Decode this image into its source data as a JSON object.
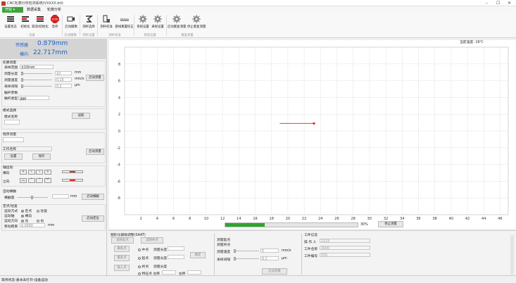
{
  "title": "CNC轮廓分析检测系统(VXXXX.btl)",
  "menu": {
    "start": "开始",
    "data": "数据采集",
    "analysis": "轮廓分析"
  },
  "ribbon": {
    "b1": "设置状态",
    "b2": "初始化",
    "b3": "取消/初始化",
    "b4": "急停",
    "b5": "启动摄像",
    "b6": "测杆选择",
    "b7": "测杆校准",
    "b8": "基线重置校正",
    "b9": "系统设置",
    "b10": "采样设置",
    "b11": "启动重复测量",
    "b12": "停止重复测量",
    "g1": "设备",
    "g2": "启动摄像",
    "g3": "测杆设置",
    "g4": "测杆校准",
    "g5": "系统设置",
    "g6": "重复测量"
  },
  "sensor": {
    "label1": "传感器",
    "value1": "0.879mm",
    "label2": "横向",
    "value2": "22.717mm"
  },
  "measure": {
    "section": "轮廓测量",
    "range_label": "采样范围",
    "range_value": "±10mm",
    "length_label": "测量长度",
    "length_value": "10",
    "length_unit": "mm",
    "speed_label": "测量速度",
    "speed_value": "0.15",
    "speed_unit": "mm/s",
    "interval_label": "采样间隔",
    "interval_value": "0.2",
    "interval_unit": "μm",
    "start_btn": "启动测量",
    "probe_params": "触杆参数",
    "probe_type_label": "触杆类型",
    "probe_type_value": "测杆"
  },
  "template": {
    "section": "模式选择",
    "name_label": "模式名称",
    "name_value": "",
    "load_btn": "读取"
  },
  "program": {
    "section": "程序测量",
    "file_label": "工作名称",
    "set_btn": "设置",
    "save_btn": "保存",
    "run_btn": "启动测量"
  },
  "motion": {
    "section": "轴运动",
    "h_label": "横向",
    "v_label": "立向"
  },
  "auto": {
    "section": "自动横触",
    "reach_label": "横触量",
    "reach_unit": "mm",
    "btn": "启动横触"
  },
  "pos": {
    "section": "定点/往复",
    "mode_label": "运动方式",
    "mode_opt1": "定点",
    "mode_opt2": "往复",
    "dir_label": "运动轴",
    "dir_opt1": "横向",
    "direction_label": "运动方向",
    "direction_opt1": "左",
    "direction_opt2": "右",
    "step_label": "移动距离",
    "step_value": "0.0000",
    "step_unit": "mm",
    "btn": "启动定位"
  },
  "chart_top": "当前温度: 19℃",
  "progress": {
    "value": 30,
    "label": "30%"
  },
  "stop_btn": "停止测量",
  "fit": {
    "title": "图形化辅助调整(SAAT)",
    "b1": "选择起点",
    "b2": "选择终点",
    "b3": "最低点",
    "b4": "最高点",
    "b5": "插入点",
    "r1": "中点",
    "r2": "起点",
    "r3": "终点",
    "r4": "特征点 左移",
    "l1": "测量长度",
    "l2": "测量长度",
    "l3": "测量长度",
    "l4": "右移",
    "confirm": "确定"
  },
  "params": {
    "start": "测量起点",
    "end": "测量终点",
    "speed_label": "测量速度",
    "speed_value": "5",
    "speed_unit": "mm/s",
    "interval_label": "采样间隔",
    "interval_value": "0.2",
    "interval_unit": "μm",
    "btn": "启动测量"
  },
  "work": {
    "title": "工件信息",
    "op_label": "操 作 人",
    "op_value": "2223",
    "name_label": "工件名称",
    "name_value": "3000",
    "no_label": "工件编号",
    "no_value": "555"
  },
  "status": "等待状态-基本未打开-设备运动",
  "chart_data": {
    "type": "line",
    "x_ticks": [
      2,
      4,
      6,
      8,
      10,
      12,
      14,
      16,
      18,
      20,
      22,
      24,
      26,
      28,
      30,
      32,
      34,
      36,
      38,
      40,
      42,
      44,
      46
    ],
    "y_ticks": [
      8,
      6,
      4,
      2,
      0,
      -2,
      -4,
      -6,
      -8
    ],
    "xlim": [
      0,
      47
    ],
    "ylim": [
      -10,
      10
    ],
    "series": [
      {
        "x": [
          19,
          23.2
        ],
        "y": [
          0.9,
          0.9
        ]
      }
    ],
    "point": {
      "x": 23.2,
      "y": 0.9
    },
    "colors": {
      "line": "#d92020",
      "grid": "#c8c8c8"
    }
  }
}
